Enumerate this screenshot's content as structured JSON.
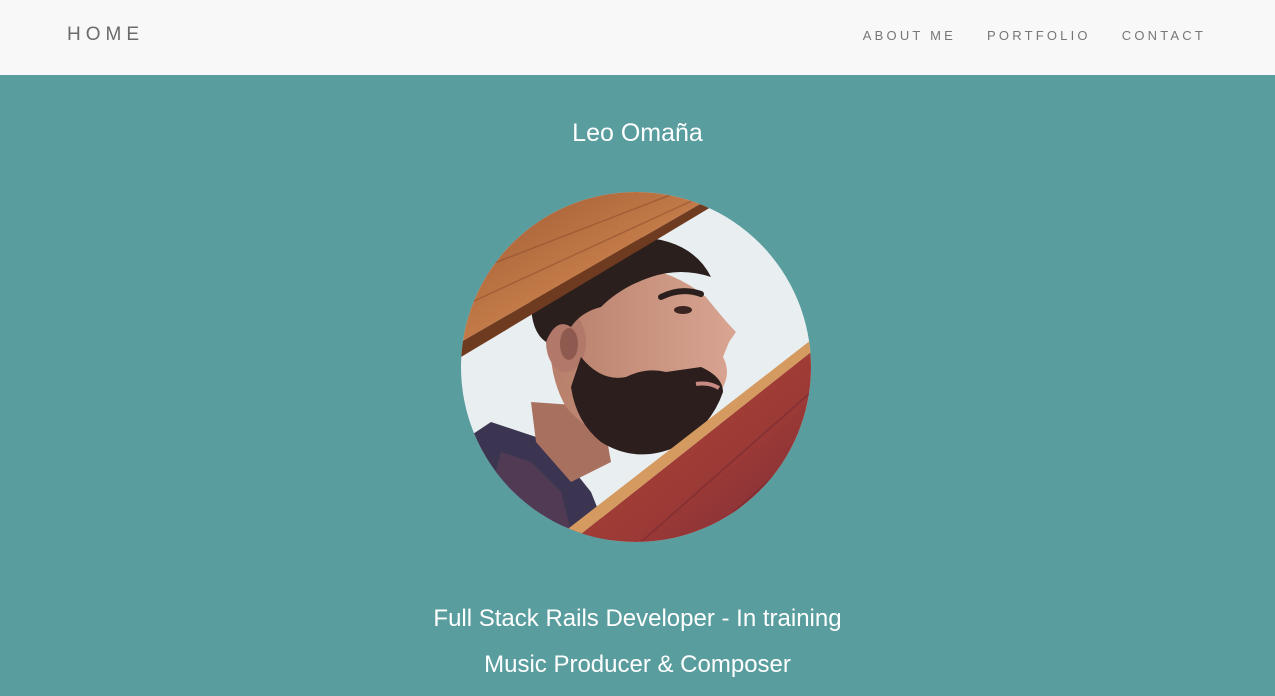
{
  "nav": {
    "brand": "HOME",
    "links": [
      {
        "label": "ABOUT ME"
      },
      {
        "label": "PORTFOLIO"
      },
      {
        "label": "CONTACT"
      }
    ]
  },
  "hero": {
    "name": "Leo Omaña",
    "avatar_alt": "Portrait photo",
    "tagline_1": "Full Stack Rails Developer - In training",
    "tagline_2": "Music Producer & Composer"
  },
  "colors": {
    "navbar_bg": "#f8f8f8",
    "hero_bg": "#5a9d9e",
    "text_light": "#ffffff",
    "nav_text": "#777777"
  }
}
